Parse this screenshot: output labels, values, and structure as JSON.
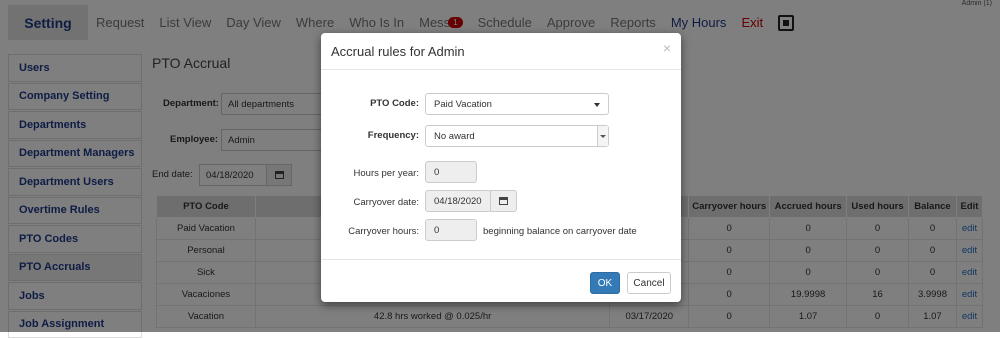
{
  "header": {
    "user": "Admin (1)",
    "nav": {
      "setting": "Setting",
      "request": "Request",
      "list_view": "List View",
      "day_view": "Day View",
      "where": "Where",
      "who_is_in": "Who Is In",
      "messages": "Mess",
      "messages_badge": "1",
      "schedule": "Schedule",
      "approve": "Approve",
      "reports": "Reports",
      "my_hours": "My Hours",
      "exit": "Exit"
    }
  },
  "sidebar": {
    "items": [
      {
        "label": "Users"
      },
      {
        "label": "Company Setting"
      },
      {
        "label": "Departments"
      },
      {
        "label": "Department Managers"
      },
      {
        "label": "Department Users"
      },
      {
        "label": "Overtime Rules"
      },
      {
        "label": "PTO Codes"
      },
      {
        "label": "PTO Accruals"
      },
      {
        "label": "Jobs"
      },
      {
        "label": "Job Assignment"
      }
    ]
  },
  "main": {
    "title": "PTO Accrual",
    "department_label": "Department:",
    "department_value": "All departments",
    "employee_label": "Employee:",
    "employee_value": "Admin",
    "end_date_label": "End date:",
    "end_date_value": "04/18/2020",
    "table": {
      "headers": {
        "pto_code": "PTO Code",
        "carryover_hours": "Carryover hours",
        "accrued_hours": "Accrued hours",
        "used_hours": "Used hours",
        "balance": "Balance",
        "edit": "Edit"
      },
      "rows": [
        {
          "code": "Paid Vacation",
          "rule": "",
          "date": "",
          "carryover": "0",
          "accrued": "0",
          "used": "0",
          "balance": "0",
          "edit": "edit"
        },
        {
          "code": "Personal",
          "rule": "",
          "date": "",
          "carryover": "0",
          "accrued": "0",
          "used": "0",
          "balance": "0",
          "edit": "edit"
        },
        {
          "code": "Sick",
          "rule": "",
          "date": "",
          "carryover": "0",
          "accrued": "0",
          "used": "0",
          "balance": "0",
          "edit": "edit"
        },
        {
          "code": "Vacaciones",
          "rule": "",
          "date": "",
          "carryover": "0",
          "accrued": "19.9998",
          "used": "16",
          "balance": "3.9998",
          "edit": "edit"
        },
        {
          "code": "Vacation",
          "rule": "42.8 hrs worked @ 0.025/hr",
          "date": "03/17/2020",
          "carryover": "0",
          "accrued": "1.07",
          "used": "0",
          "balance": "1.07",
          "edit": "edit"
        }
      ]
    }
  },
  "modal": {
    "title": "Accrual rules for Admin",
    "close": "×",
    "pto_code_label": "PTO Code:",
    "pto_code_value": "Paid Vacation",
    "frequency_label": "Frequency:",
    "frequency_value": "No award",
    "hours_per_year_label": "Hours per year:",
    "hours_per_year_value": "0",
    "carryover_date_label": "Carryover date:",
    "carryover_date_value": "04/18/2020",
    "carryover_hours_label": "Carryover hours:",
    "carryover_hours_value": "0",
    "carryover_hours_hint": "beginning balance on carryover date",
    "ok": "OK",
    "cancel": "Cancel"
  }
}
